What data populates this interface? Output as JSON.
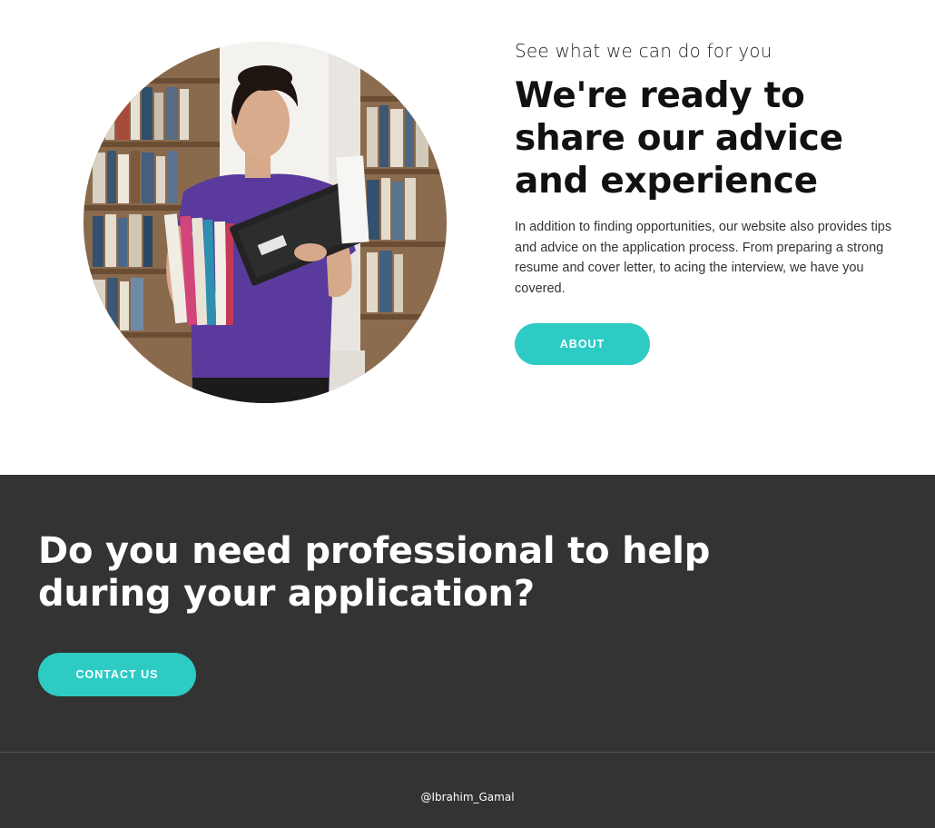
{
  "about": {
    "image_alt": "Woman holding books in a library",
    "eyebrow": "See what we can do for you",
    "heading": "We're ready to share our advice and experience",
    "body": "In addition to finding opportunities, our website also provides tips and advice on the application process. From preparing a strong resume and cover letter, to acing the interview, we have you covered.",
    "button_label": "ABOUT"
  },
  "cta": {
    "heading": "Do you need professional to help during your application?",
    "button_label": "CONTACT US"
  },
  "footer": {
    "credit": "@Ibrahim_Gamal"
  },
  "colors": {
    "accent": "#2ecbc5",
    "dark_bg": "#333333",
    "text_dark": "#111111"
  }
}
